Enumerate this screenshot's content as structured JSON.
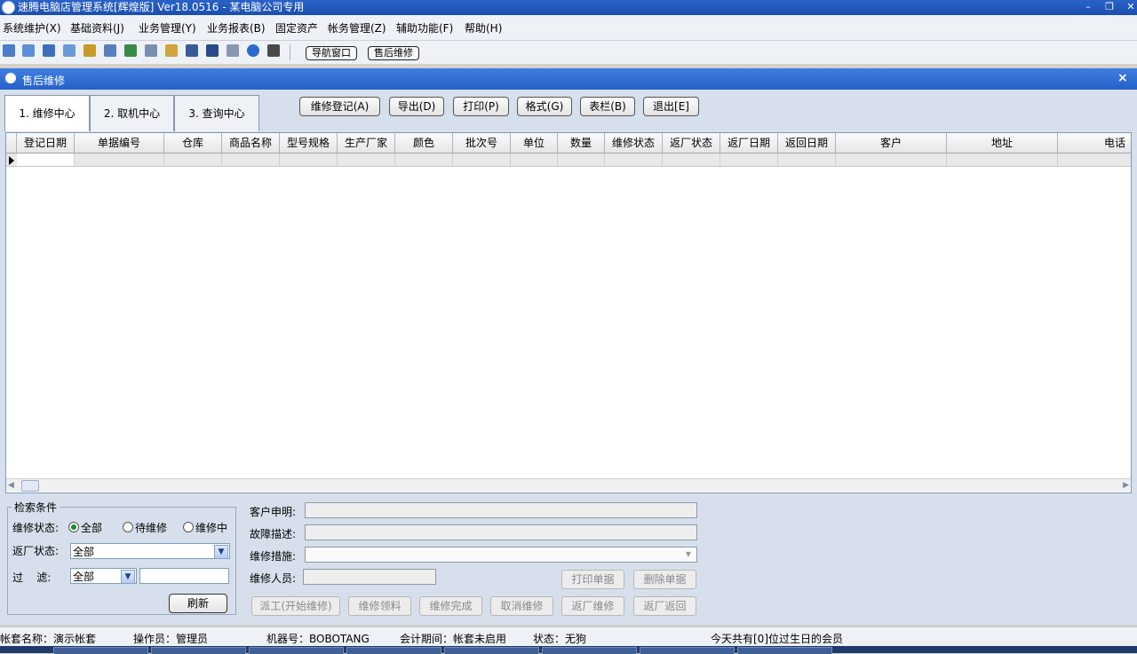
{
  "window": {
    "title": "速腾电脑店管理系统[辉煌版] Ver18.0516  - 某电脑公司专用"
  },
  "menu": [
    "系统维护(X)",
    "基础资料(J)",
    "业务管理(Y)",
    "业务报表(B)",
    "固定资产",
    "帐务管理(Z)",
    "辅助功能(F)",
    "帮助(H)"
  ],
  "toolbar": {
    "icons": [
      "grid-icon",
      "form-icon",
      "window-icon",
      "monitor-icon",
      "mail-icon",
      "refresh-icon",
      "users-icon",
      "printer-setup-icon",
      "folder-icon",
      "screen-icon",
      "save-icon",
      "print-icon",
      "help-icon",
      "exit-icon"
    ],
    "nav_button": "导航窗口",
    "aftersale_button": "售后维修"
  },
  "inner_window": {
    "title": "售后维修",
    "tabs": [
      "1. 维修中心",
      "2. 取机中心",
      "3. 查询中心"
    ],
    "actions": [
      "维修登记(A)",
      "导出(D)",
      "打印(P)",
      "格式(G)",
      "表栏(B)",
      "退出[E]"
    ]
  },
  "grid": {
    "columns": [
      "登记日期",
      "单据编号",
      "仓库",
      "商品名称",
      "型号规格",
      "生产厂家",
      "颜色",
      "批次号",
      "单位",
      "数量",
      "维修状态",
      "返厂状态",
      "返厂日期",
      "返回日期",
      "客户",
      "地址",
      "电话"
    ]
  },
  "search": {
    "legend": "检索条件",
    "repair_status_label": "维修状态:",
    "radios": [
      "全部",
      "待维修",
      "维修中"
    ],
    "return_status_label": "返厂状态:",
    "return_status_value": "全部",
    "filter_label": "过    滤:",
    "filter_value": "全部",
    "refresh_button": "刷新"
  },
  "details": {
    "customer_statement_label": "客户申明:",
    "fault_label": "故障描述:",
    "measures_label": "维修措施:",
    "staff_label": "维修人员:",
    "print_button": "打印单据",
    "delete_button": "删除单据",
    "workflow_buttons": [
      "派工(开始维修)",
      "维修领料",
      "维修完成",
      "取消维修",
      "返厂维修",
      "返厂返回"
    ]
  },
  "status": {
    "account": "帐套名称：演示帐套",
    "operator": "操作员：管理员",
    "machine": "机器号：BOBOTANG",
    "period": "会计期间：帐套未启用",
    "state": "状态：无狗",
    "birthday": "今天共有[0]位过生日的会员"
  }
}
